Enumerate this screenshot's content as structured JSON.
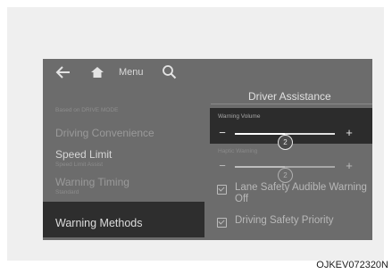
{
  "topbar": {
    "back_icon": "back-arrow-icon",
    "home_icon": "home-icon",
    "menu_label": "Menu",
    "search_icon": "search-icon"
  },
  "left_panel": {
    "caption": "Based on DRIVE MODE",
    "items": [
      {
        "label": "Driving Convenience",
        "sub": ""
      },
      {
        "label": "Speed Limit",
        "sub": "Speed Limit Assist"
      },
      {
        "label": "Warning Timing",
        "sub": "Standard"
      },
      {
        "label": "Warning Methods",
        "sub": "",
        "selected": true
      }
    ]
  },
  "right_panel": {
    "title": "Driver Assistance",
    "warning_volume": {
      "caption": "Warning Volume",
      "minus": "−",
      "plus": "+",
      "value": "2",
      "level": 0.5
    },
    "haptic_warning": {
      "caption": "Haptic Warning",
      "minus": "−",
      "plus": "+",
      "value": "2",
      "level": 0.5
    },
    "options": [
      {
        "label": "Lane Safety Audible Warning Off",
        "checked": true
      },
      {
        "label": "Driving Safety Priority",
        "checked": true
      }
    ]
  },
  "figure_code": "OJKEV072320N",
  "colors": {
    "screen_bg": "#6c6c6c",
    "highlight_bg": "#2c2c2c",
    "frame_bg": "#efefef"
  }
}
